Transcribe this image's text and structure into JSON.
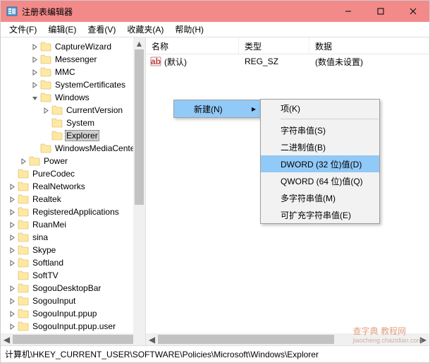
{
  "window": {
    "title": "注册表编辑器"
  },
  "menubar": [
    {
      "label": "文件(F)"
    },
    {
      "label": "编辑(E)"
    },
    {
      "label": "查看(V)"
    },
    {
      "label": "收藏夹(A)"
    },
    {
      "label": "帮助(H)"
    }
  ],
  "tree": [
    {
      "depth": 2,
      "toggle": "closed",
      "label": "CaptureWizard"
    },
    {
      "depth": 2,
      "toggle": "closed",
      "label": "Messenger"
    },
    {
      "depth": 2,
      "toggle": "closed",
      "label": "MMC"
    },
    {
      "depth": 2,
      "toggle": "closed",
      "label": "SystemCertificates"
    },
    {
      "depth": 2,
      "toggle": "open",
      "label": "Windows"
    },
    {
      "depth": 3,
      "toggle": "closed",
      "label": "CurrentVersion"
    },
    {
      "depth": 3,
      "toggle": "none",
      "label": "System"
    },
    {
      "depth": 3,
      "toggle": "none",
      "label": "Explorer",
      "selected": true
    },
    {
      "depth": 2,
      "toggle": "none",
      "label": "WindowsMediaCenter"
    },
    {
      "depth": 1,
      "toggle": "closed",
      "label": "Power"
    },
    {
      "depth": 0,
      "toggle": "none",
      "label": "PureCodec"
    },
    {
      "depth": 0,
      "toggle": "closed",
      "label": "RealNetworks"
    },
    {
      "depth": 0,
      "toggle": "closed",
      "label": "Realtek"
    },
    {
      "depth": 0,
      "toggle": "closed",
      "label": "RegisteredApplications"
    },
    {
      "depth": 0,
      "toggle": "closed",
      "label": "RuanMei"
    },
    {
      "depth": 0,
      "toggle": "closed",
      "label": "sina"
    },
    {
      "depth": 0,
      "toggle": "closed",
      "label": "Skype"
    },
    {
      "depth": 0,
      "toggle": "closed",
      "label": "Softland"
    },
    {
      "depth": 0,
      "toggle": "none",
      "label": "SoftTV"
    },
    {
      "depth": 0,
      "toggle": "closed",
      "label": "SogouDesktopBar"
    },
    {
      "depth": 0,
      "toggle": "closed",
      "label": "SogouInput"
    },
    {
      "depth": 0,
      "toggle": "closed",
      "label": "SogouInput.ppup"
    },
    {
      "depth": 0,
      "toggle": "closed",
      "label": "SogouInput.ppup.user"
    }
  ],
  "list": {
    "columns": {
      "name": "名称",
      "type": "类型",
      "data": "数据"
    },
    "rows": [
      {
        "name": "(默认)",
        "type": "REG_SZ",
        "data": "(数值未设置)"
      }
    ]
  },
  "context": {
    "parent": {
      "label": "新建(N)"
    },
    "sub": [
      {
        "label": "项(K)",
        "sep_after": true
      },
      {
        "label": "字符串值(S)"
      },
      {
        "label": "二进制值(B)"
      },
      {
        "label": "DWORD (32 位)值(D)",
        "highlight": true
      },
      {
        "label": "QWORD (64 位)值(Q)"
      },
      {
        "label": "多字符串值(M)"
      },
      {
        "label": "可扩充字符串值(E)"
      }
    ]
  },
  "statusbar": {
    "path": "计算机\\HKEY_CURRENT_USER\\SOFTWARE\\Policies\\Microsoft\\Windows\\Explorer"
  },
  "watermark": {
    "main": "查字典",
    "sub": "jiaocheng.chazidian.com",
    "tag": "教程网"
  }
}
